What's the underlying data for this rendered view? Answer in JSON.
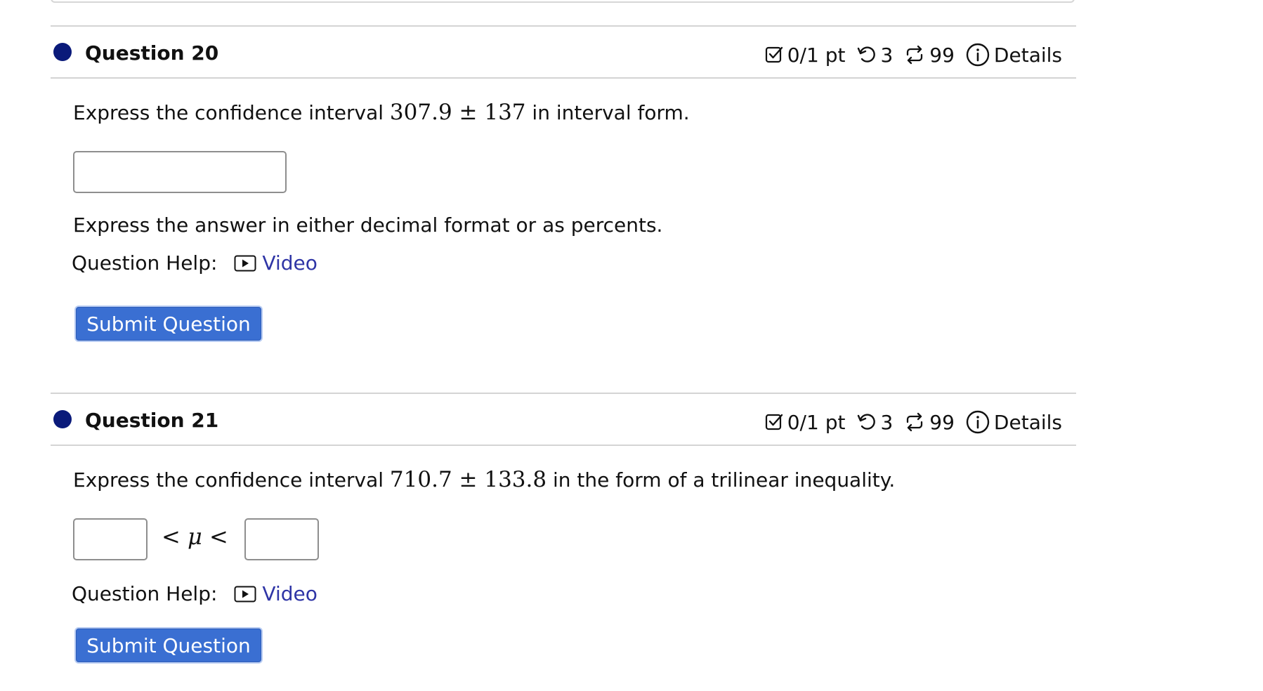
{
  "questions": [
    {
      "title": "Question 20",
      "points": "0/1 pt",
      "retries": "3",
      "attempts": "99",
      "details_label": "Details",
      "prompt_pre": "Express the confidence interval ",
      "prompt_math": "307.9 ± 137",
      "prompt_post": " in interval form.",
      "note": "Express the answer in either decimal format or as percents.",
      "help_label": "Question Help:",
      "video_label": "Video",
      "submit_label": "Submit Question",
      "answer_value": ""
    },
    {
      "title": "Question 21",
      "points": "0/1 pt",
      "retries": "3",
      "attempts": "99",
      "details_label": "Details",
      "prompt_pre": "Express the confidence interval ",
      "prompt_math": "710.7 ± 133.8",
      "prompt_post": " in the form of a trilinear inequality.",
      "inequality_lt1": "<",
      "inequality_mu": "μ",
      "inequality_lt2": "<",
      "lower_value": "",
      "upper_value": "",
      "help_label": "Question Help:",
      "video_label": "Video",
      "submit_label": "Submit Question"
    }
  ],
  "icons": {
    "points": "checkbox-icon",
    "retries": "undo-icon",
    "attempts": "repeat-icon",
    "details": "info-icon",
    "video": "video-play-icon"
  },
  "colors": {
    "status_dot": "#0a1a7a",
    "link": "#2f35a6",
    "submit_bg": "#3a6fd2"
  }
}
